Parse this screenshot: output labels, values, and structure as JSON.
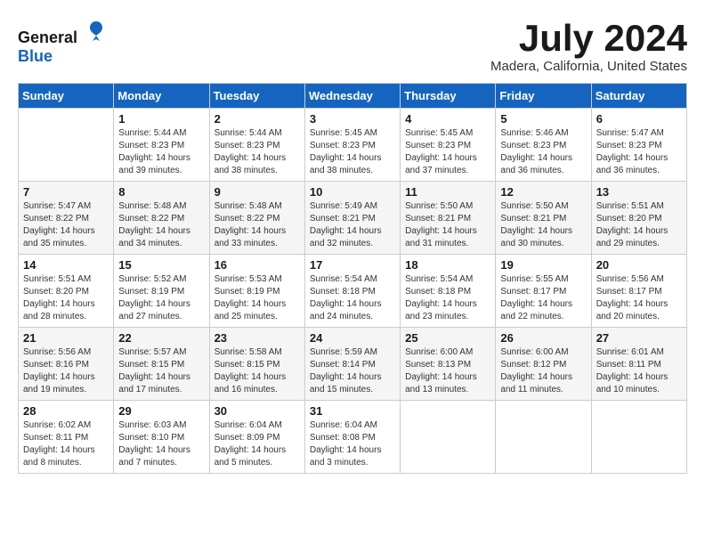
{
  "logo": {
    "general": "General",
    "blue": "Blue"
  },
  "title": "July 2024",
  "location": "Madera, California, United States",
  "days_of_week": [
    "Sunday",
    "Monday",
    "Tuesday",
    "Wednesday",
    "Thursday",
    "Friday",
    "Saturday"
  ],
  "weeks": [
    [
      {
        "day": "",
        "sunrise": "",
        "sunset": "",
        "daylight": ""
      },
      {
        "day": "1",
        "sunrise": "Sunrise: 5:44 AM",
        "sunset": "Sunset: 8:23 PM",
        "daylight": "Daylight: 14 hours and 39 minutes."
      },
      {
        "day": "2",
        "sunrise": "Sunrise: 5:44 AM",
        "sunset": "Sunset: 8:23 PM",
        "daylight": "Daylight: 14 hours and 38 minutes."
      },
      {
        "day": "3",
        "sunrise": "Sunrise: 5:45 AM",
        "sunset": "Sunset: 8:23 PM",
        "daylight": "Daylight: 14 hours and 38 minutes."
      },
      {
        "day": "4",
        "sunrise": "Sunrise: 5:45 AM",
        "sunset": "Sunset: 8:23 PM",
        "daylight": "Daylight: 14 hours and 37 minutes."
      },
      {
        "day": "5",
        "sunrise": "Sunrise: 5:46 AM",
        "sunset": "Sunset: 8:23 PM",
        "daylight": "Daylight: 14 hours and 36 minutes."
      },
      {
        "day": "6",
        "sunrise": "Sunrise: 5:47 AM",
        "sunset": "Sunset: 8:23 PM",
        "daylight": "Daylight: 14 hours and 36 minutes."
      }
    ],
    [
      {
        "day": "7",
        "sunrise": "Sunrise: 5:47 AM",
        "sunset": "Sunset: 8:22 PM",
        "daylight": "Daylight: 14 hours and 35 minutes."
      },
      {
        "day": "8",
        "sunrise": "Sunrise: 5:48 AM",
        "sunset": "Sunset: 8:22 PM",
        "daylight": "Daylight: 14 hours and 34 minutes."
      },
      {
        "day": "9",
        "sunrise": "Sunrise: 5:48 AM",
        "sunset": "Sunset: 8:22 PM",
        "daylight": "Daylight: 14 hours and 33 minutes."
      },
      {
        "day": "10",
        "sunrise": "Sunrise: 5:49 AM",
        "sunset": "Sunset: 8:21 PM",
        "daylight": "Daylight: 14 hours and 32 minutes."
      },
      {
        "day": "11",
        "sunrise": "Sunrise: 5:50 AM",
        "sunset": "Sunset: 8:21 PM",
        "daylight": "Daylight: 14 hours and 31 minutes."
      },
      {
        "day": "12",
        "sunrise": "Sunrise: 5:50 AM",
        "sunset": "Sunset: 8:21 PM",
        "daylight": "Daylight: 14 hours and 30 minutes."
      },
      {
        "day": "13",
        "sunrise": "Sunrise: 5:51 AM",
        "sunset": "Sunset: 8:20 PM",
        "daylight": "Daylight: 14 hours and 29 minutes."
      }
    ],
    [
      {
        "day": "14",
        "sunrise": "Sunrise: 5:51 AM",
        "sunset": "Sunset: 8:20 PM",
        "daylight": "Daylight: 14 hours and 28 minutes."
      },
      {
        "day": "15",
        "sunrise": "Sunrise: 5:52 AM",
        "sunset": "Sunset: 8:19 PM",
        "daylight": "Daylight: 14 hours and 27 minutes."
      },
      {
        "day": "16",
        "sunrise": "Sunrise: 5:53 AM",
        "sunset": "Sunset: 8:19 PM",
        "daylight": "Daylight: 14 hours and 25 minutes."
      },
      {
        "day": "17",
        "sunrise": "Sunrise: 5:54 AM",
        "sunset": "Sunset: 8:18 PM",
        "daylight": "Daylight: 14 hours and 24 minutes."
      },
      {
        "day": "18",
        "sunrise": "Sunrise: 5:54 AM",
        "sunset": "Sunset: 8:18 PM",
        "daylight": "Daylight: 14 hours and 23 minutes."
      },
      {
        "day": "19",
        "sunrise": "Sunrise: 5:55 AM",
        "sunset": "Sunset: 8:17 PM",
        "daylight": "Daylight: 14 hours and 22 minutes."
      },
      {
        "day": "20",
        "sunrise": "Sunrise: 5:56 AM",
        "sunset": "Sunset: 8:17 PM",
        "daylight": "Daylight: 14 hours and 20 minutes."
      }
    ],
    [
      {
        "day": "21",
        "sunrise": "Sunrise: 5:56 AM",
        "sunset": "Sunset: 8:16 PM",
        "daylight": "Daylight: 14 hours and 19 minutes."
      },
      {
        "day": "22",
        "sunrise": "Sunrise: 5:57 AM",
        "sunset": "Sunset: 8:15 PM",
        "daylight": "Daylight: 14 hours and 17 minutes."
      },
      {
        "day": "23",
        "sunrise": "Sunrise: 5:58 AM",
        "sunset": "Sunset: 8:15 PM",
        "daylight": "Daylight: 14 hours and 16 minutes."
      },
      {
        "day": "24",
        "sunrise": "Sunrise: 5:59 AM",
        "sunset": "Sunset: 8:14 PM",
        "daylight": "Daylight: 14 hours and 15 minutes."
      },
      {
        "day": "25",
        "sunrise": "Sunrise: 6:00 AM",
        "sunset": "Sunset: 8:13 PM",
        "daylight": "Daylight: 14 hours and 13 minutes."
      },
      {
        "day": "26",
        "sunrise": "Sunrise: 6:00 AM",
        "sunset": "Sunset: 8:12 PM",
        "daylight": "Daylight: 14 hours and 11 minutes."
      },
      {
        "day": "27",
        "sunrise": "Sunrise: 6:01 AM",
        "sunset": "Sunset: 8:11 PM",
        "daylight": "Daylight: 14 hours and 10 minutes."
      }
    ],
    [
      {
        "day": "28",
        "sunrise": "Sunrise: 6:02 AM",
        "sunset": "Sunset: 8:11 PM",
        "daylight": "Daylight: 14 hours and 8 minutes."
      },
      {
        "day": "29",
        "sunrise": "Sunrise: 6:03 AM",
        "sunset": "Sunset: 8:10 PM",
        "daylight": "Daylight: 14 hours and 7 minutes."
      },
      {
        "day": "30",
        "sunrise": "Sunrise: 6:04 AM",
        "sunset": "Sunset: 8:09 PM",
        "daylight": "Daylight: 14 hours and 5 minutes."
      },
      {
        "day": "31",
        "sunrise": "Sunrise: 6:04 AM",
        "sunset": "Sunset: 8:08 PM",
        "daylight": "Daylight: 14 hours and 3 minutes."
      },
      {
        "day": "",
        "sunrise": "",
        "sunset": "",
        "daylight": ""
      },
      {
        "day": "",
        "sunrise": "",
        "sunset": "",
        "daylight": ""
      },
      {
        "day": "",
        "sunrise": "",
        "sunset": "",
        "daylight": ""
      }
    ]
  ]
}
